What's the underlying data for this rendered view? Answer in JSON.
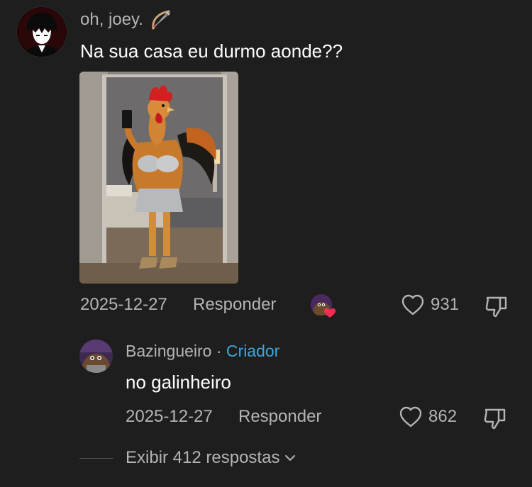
{
  "comment": {
    "username": "oh, joey.",
    "username_emoji_icon": "bow-and-arrow-icon",
    "text": "Na sua casa eu durmo aonde??",
    "image_description_icon": "rooster-selfie-image",
    "date": "2025-12-27",
    "reply_label": "Responder",
    "like_count": "931"
  },
  "reply": {
    "username": "Bazingueiro",
    "separator": " · ",
    "creator_label": "Criador",
    "text": "no galinheiro",
    "date": "2025-12-27",
    "reply_label": "Responder",
    "like_count": "862"
  },
  "view_replies": {
    "label": "Exibir 412 respostas"
  },
  "colors": {
    "background": "#1e1e1e",
    "secondary_text": "#b4b4b4",
    "primary_text": "#ffffff",
    "creator_accent": "#3ea6d9",
    "heart_badge": "#fe2c55"
  }
}
